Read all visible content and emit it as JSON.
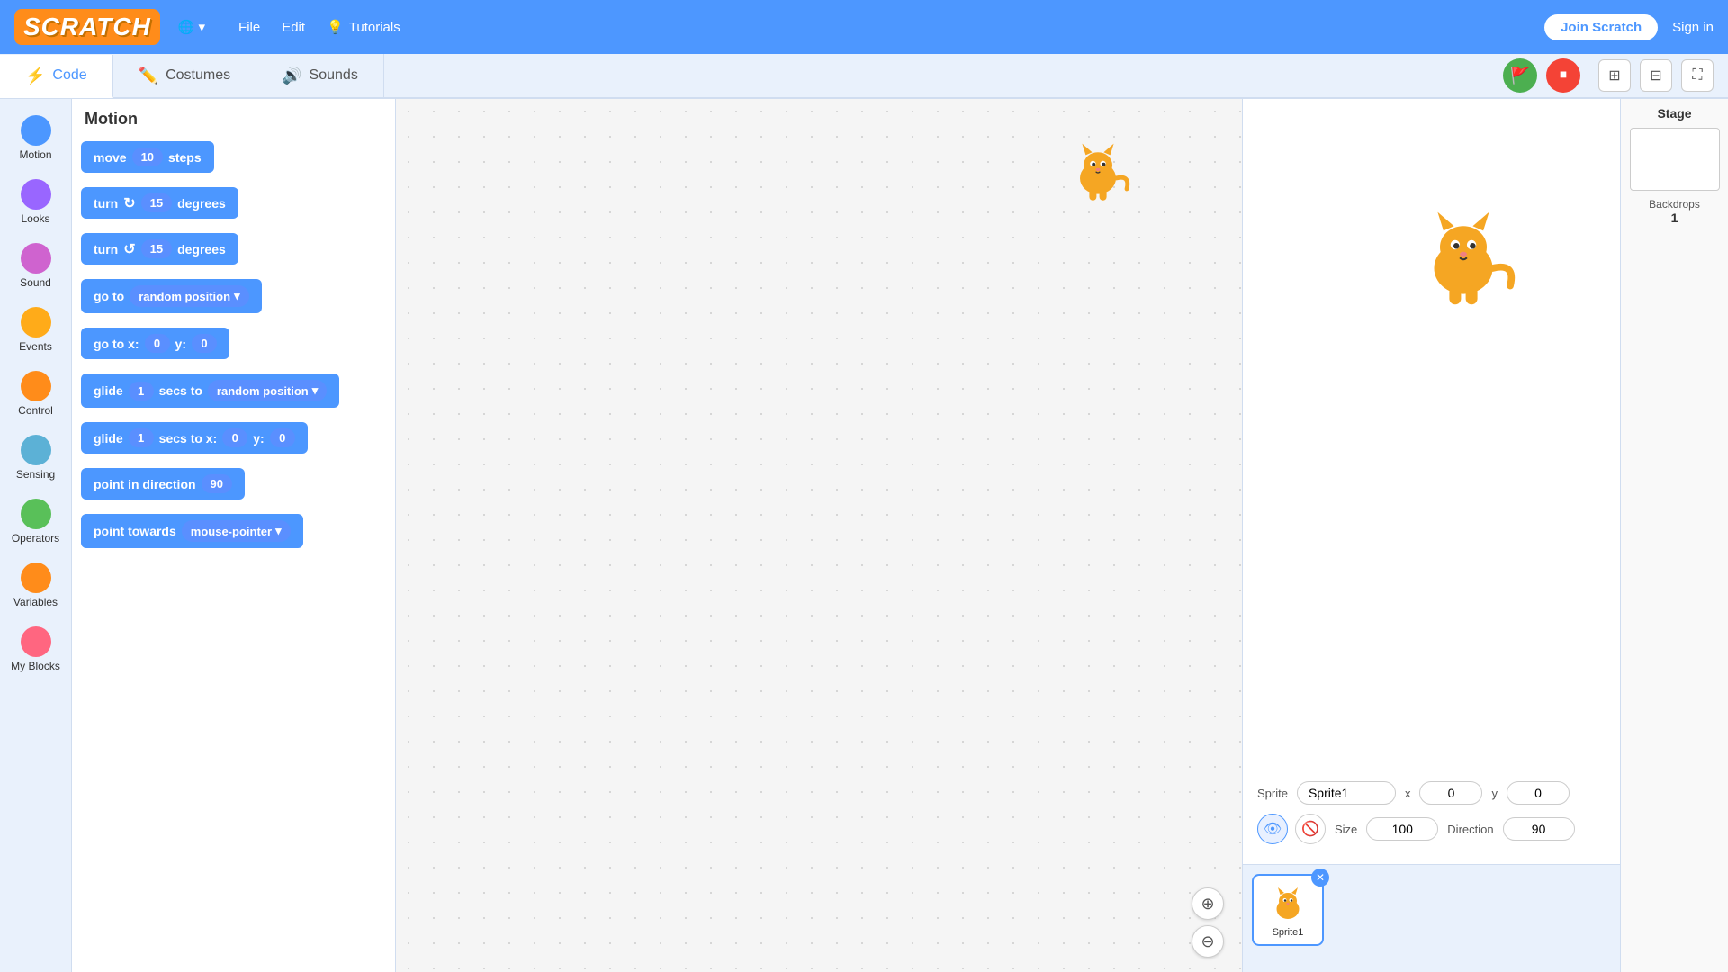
{
  "app": {
    "logo": "SCRATCH",
    "nav_items": [
      {
        "label": "File",
        "id": "file"
      },
      {
        "label": "Edit",
        "id": "edit"
      },
      {
        "label": "Tutorials",
        "id": "tutorials",
        "icon": "💡"
      }
    ],
    "globe_label": "🌐",
    "join_label": "Join Scratch",
    "signin_label": "Sign in"
  },
  "subtabs": [
    {
      "label": "Code",
      "icon": "⚡",
      "active": true,
      "id": "code"
    },
    {
      "label": "Costumes",
      "icon": "✏️",
      "active": false,
      "id": "costumes"
    },
    {
      "label": "Sounds",
      "icon": "🔊",
      "active": false,
      "id": "sounds"
    }
  ],
  "sidebar": {
    "items": [
      {
        "label": "Motion",
        "color": "#4c97ff",
        "id": "motion"
      },
      {
        "label": "Looks",
        "color": "#9966ff",
        "id": "looks"
      },
      {
        "label": "Sound",
        "color": "#cf63cf",
        "id": "sound"
      },
      {
        "label": "Events",
        "color": "#ffab19",
        "id": "events"
      },
      {
        "label": "Control",
        "color": "#ffab19",
        "id": "control",
        "color2": "#ff8c1a"
      },
      {
        "label": "Sensing",
        "color": "#5cb1d6",
        "id": "sensing"
      },
      {
        "label": "Operators",
        "color": "#59c059",
        "id": "operators"
      },
      {
        "label": "Variables",
        "color": "#ff8c1a",
        "id": "variables"
      },
      {
        "label": "My Blocks",
        "color": "#ff6680",
        "id": "myblocks"
      }
    ]
  },
  "blocks_panel": {
    "title": "Motion",
    "blocks": [
      {
        "id": "move",
        "template": "move_steps",
        "label": "move",
        "input": "10",
        "suffix": "steps"
      },
      {
        "id": "turn_cw",
        "template": "turn_cw",
        "label": "turn",
        "icon": "↻",
        "input": "15",
        "suffix": "degrees"
      },
      {
        "id": "turn_ccw",
        "template": "turn_ccw",
        "label": "turn",
        "icon": "↺",
        "input": "15",
        "suffix": "degrees"
      },
      {
        "id": "goto",
        "template": "goto",
        "label": "go to",
        "dropdown": "random position"
      },
      {
        "id": "goto_xy",
        "template": "goto_xy",
        "label": "go to x:",
        "x": "0",
        "y_label": "y:",
        "y": "0"
      },
      {
        "id": "glide_random",
        "template": "glide_random",
        "label": "glide",
        "input": "1",
        "middle": "secs to",
        "dropdown": "random position"
      },
      {
        "id": "glide_xy",
        "template": "glide_xy",
        "label": "glide",
        "input": "1",
        "middle": "secs to x:",
        "x": "0",
        "y_label": "y:",
        "y": "0"
      },
      {
        "id": "point_dir",
        "template": "point_dir",
        "label": "point in direction",
        "input": "90"
      },
      {
        "id": "point_towards",
        "template": "point_towards",
        "label": "point towards",
        "dropdown": "mouse-pointer"
      }
    ]
  },
  "stage_controls": {
    "green_flag": "▶",
    "red_stop": "⬛"
  },
  "stage_preview": {
    "cat_emoji": "🐱"
  },
  "sprite_info": {
    "sprite_label": "Sprite",
    "sprite_name": "Sprite1",
    "x_label": "x",
    "x_value": "0",
    "y_label": "y",
    "y_value": "0",
    "size_label": "Size",
    "size_value": "100",
    "direction_label": "Direction",
    "direction_value": "90"
  },
  "sprite_thumbnails": [
    {
      "name": "Sprite1",
      "emoji": "🐱",
      "active": true
    }
  ],
  "stage_panel": {
    "title": "Stage",
    "backdrops_label": "Backdrops",
    "backdrops_count": "1"
  },
  "layout_buttons": [
    {
      "id": "layout1",
      "icon": "⊞"
    },
    {
      "id": "layout2",
      "icon": "⊟"
    },
    {
      "id": "fullscreen",
      "icon": "⛶"
    }
  ]
}
